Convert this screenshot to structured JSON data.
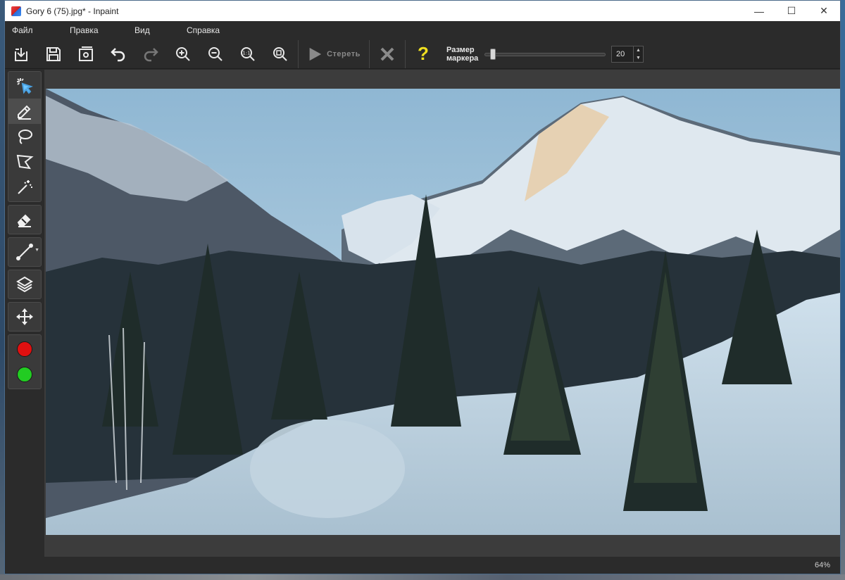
{
  "window": {
    "title": "Gory 6 (75).jpg* - Inpaint",
    "controls": {
      "minimize": "—",
      "maximize": "☐",
      "close": "✕"
    }
  },
  "menu": {
    "items": [
      {
        "label": "Файл"
      },
      {
        "label": "Правка"
      },
      {
        "label": "Вид"
      },
      {
        "label": "Справка"
      }
    ]
  },
  "toolbar": {
    "erase_label": "Стереть",
    "help_glyph": "?",
    "marker_label_line1": "Размер",
    "marker_label_line2": "маркера",
    "marker_size": "20",
    "marker_slider_fraction": 0.05,
    "zoom_100_label": "1:1"
  },
  "sidebar": {
    "tools": [
      {
        "name": "magic-select"
      },
      {
        "name": "marker",
        "active": true
      },
      {
        "name": "lasso"
      },
      {
        "name": "polygonal-lasso"
      },
      {
        "name": "magic-wand"
      },
      {
        "name": "eraser"
      },
      {
        "name": "guide-line"
      },
      {
        "name": "layers"
      },
      {
        "name": "move"
      }
    ],
    "colors": {
      "red": "#e01010",
      "green": "#22cc22"
    }
  },
  "colors": {
    "background": "#2b2b2b",
    "canvas": "#3c3c3c",
    "accent_help": "#f0e020"
  },
  "status": {
    "zoom": "64%"
  }
}
